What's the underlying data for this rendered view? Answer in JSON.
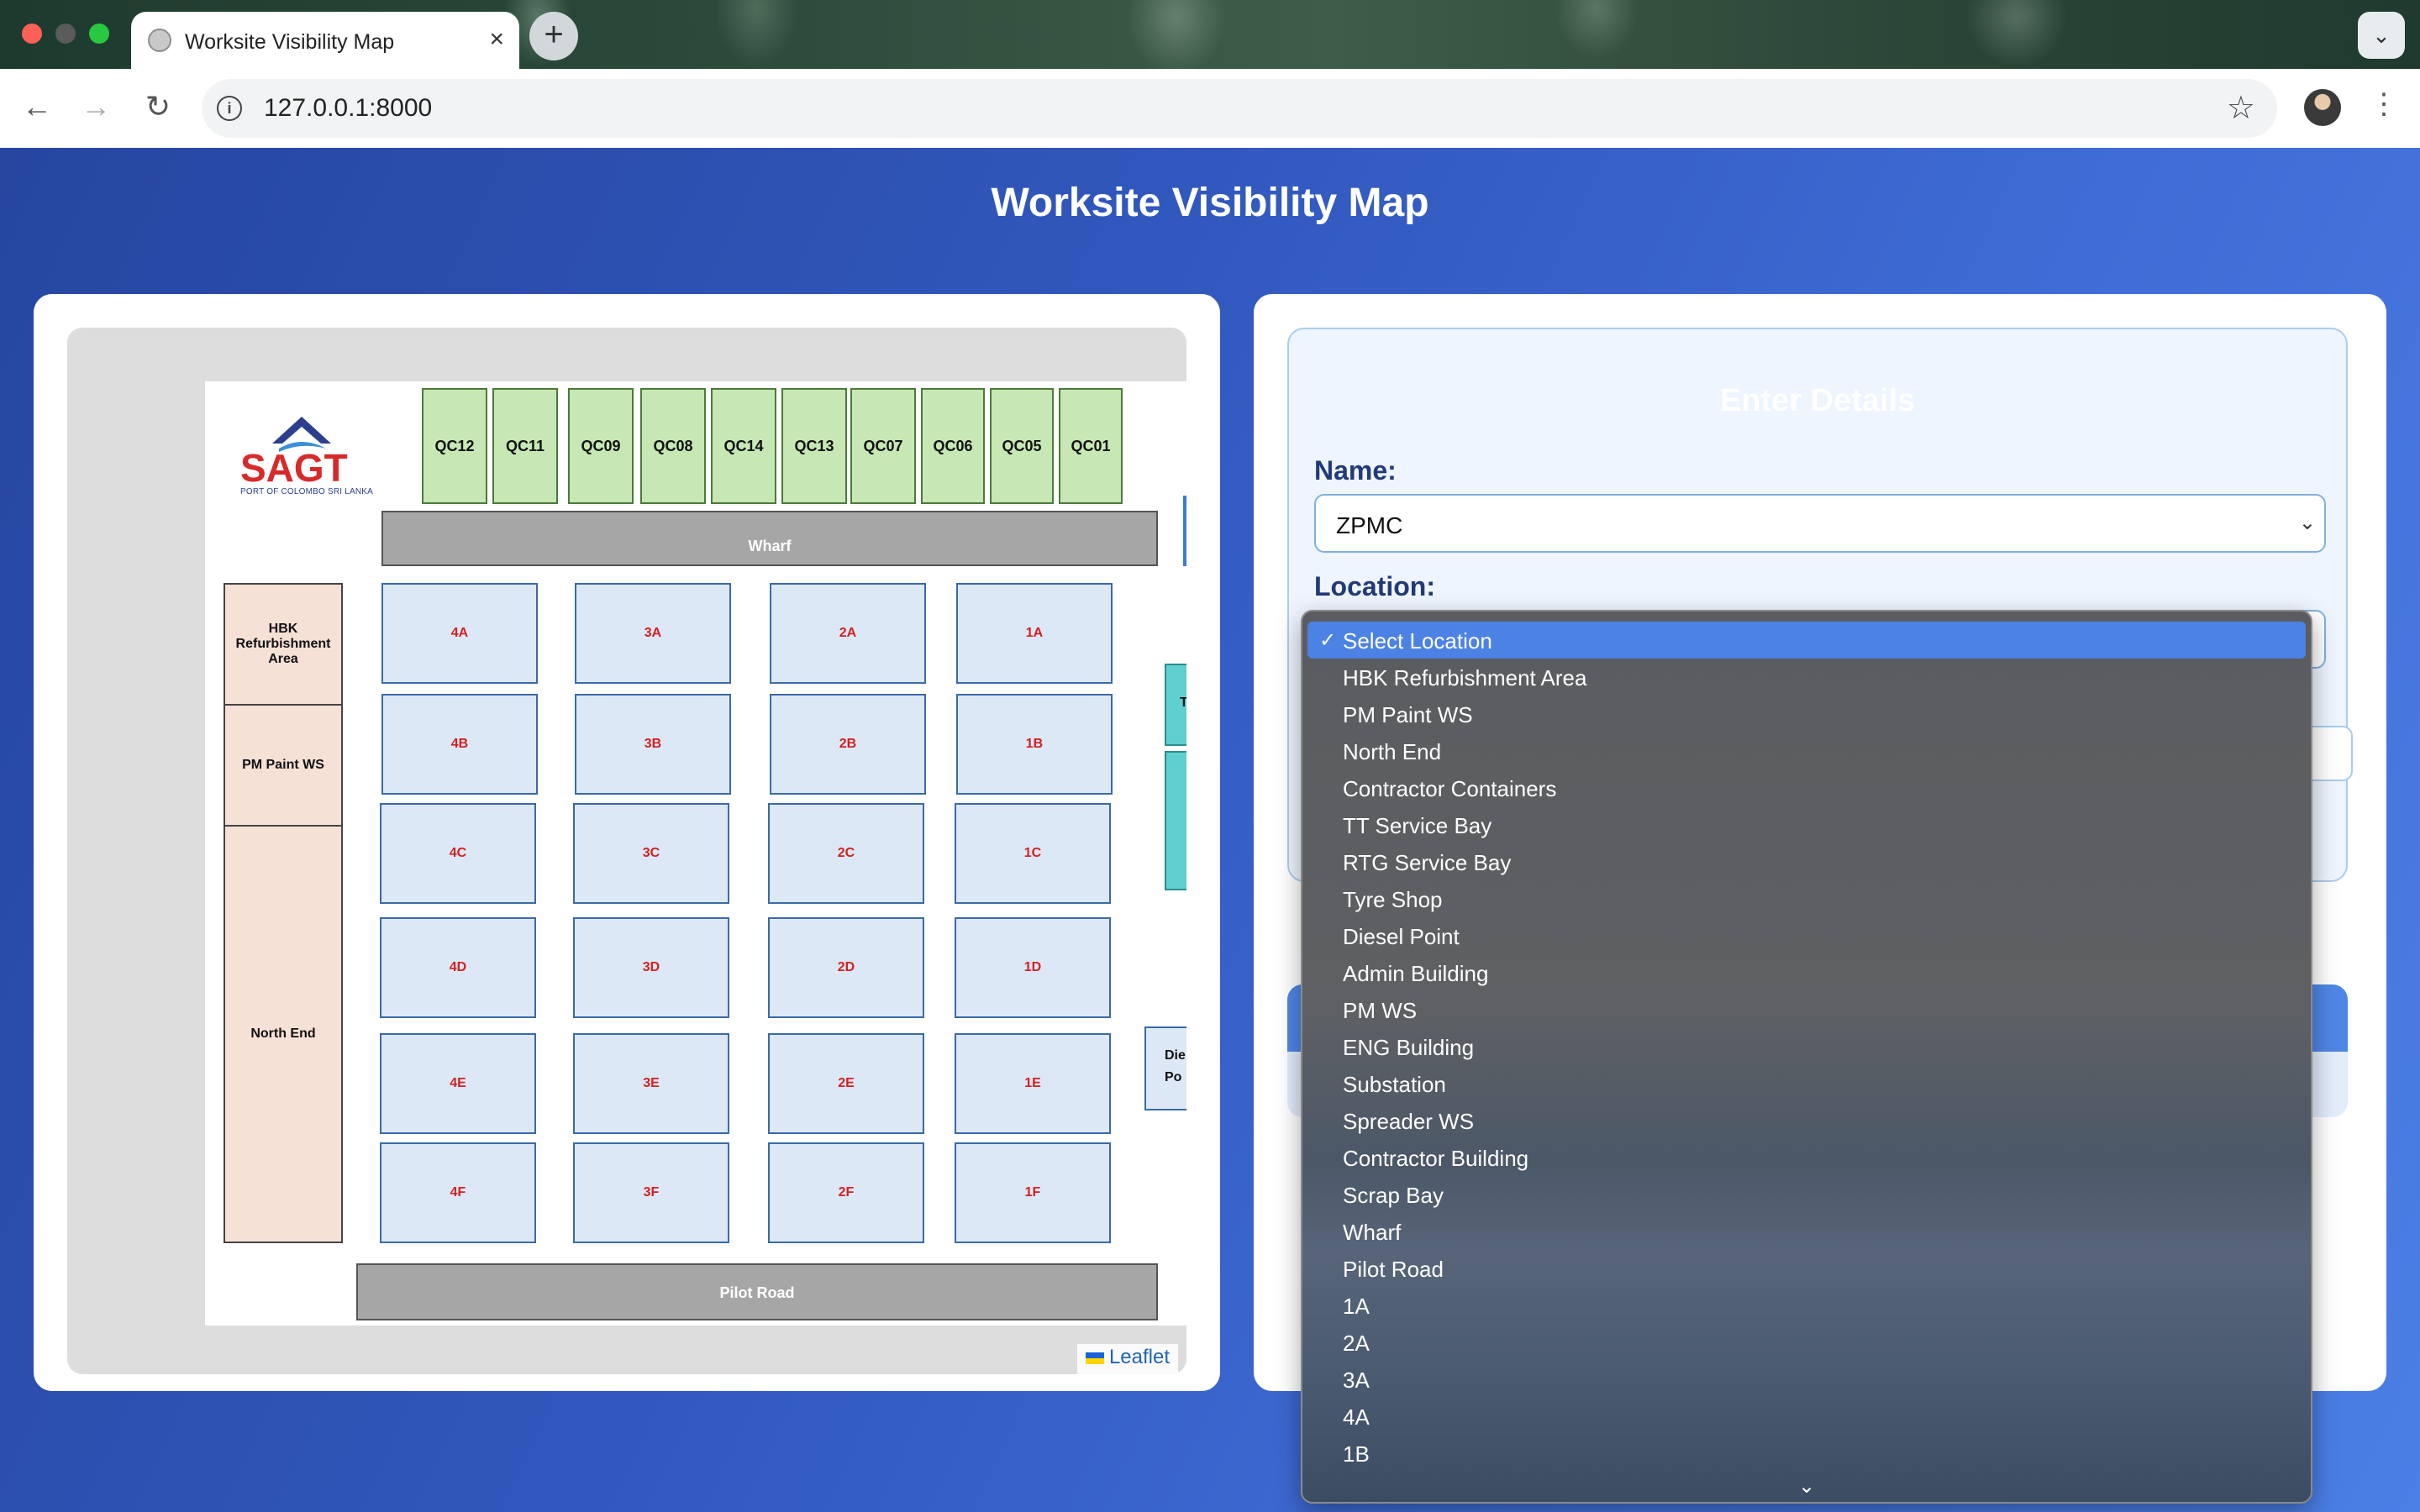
{
  "browser": {
    "tab_title": "Worksite Visibility Map",
    "tab_close": "×",
    "new_tab": "+",
    "tab_menu": "⌄",
    "url": "127.0.0.1:8000",
    "info_glyph": "i",
    "back": "←",
    "forward": "→",
    "reload": "↻",
    "star": "☆",
    "menu": "⋮"
  },
  "page": {
    "title": "Worksite Visibility Map"
  },
  "map": {
    "logo": {
      "name": "SAGT",
      "tagline": "PORT OF COLOMBO SRI LANKA"
    },
    "cranes": [
      "QC12",
      "QC11",
      "QC09",
      "QC08",
      "QC14",
      "QC13",
      "QC07",
      "QC06",
      "QC05",
      "QC01"
    ],
    "wharf": "Wharf",
    "pilot_road": "Pilot Road",
    "zones": {
      "hbk": "HBK Refurbishment Area",
      "pm_paint": "PM Paint WS",
      "north_end": "North End"
    },
    "blocks": [
      [
        "4A",
        "3A",
        "2A",
        "1A"
      ],
      [
        "4B",
        "3B",
        "2B",
        "1B"
      ],
      [
        "4C",
        "3C",
        "2C",
        "1C"
      ],
      [
        "4D",
        "3D",
        "2D",
        "1D"
      ],
      [
        "4E",
        "3E",
        "2E",
        "1E"
      ],
      [
        "4F",
        "3F",
        "2F",
        "1F"
      ]
    ],
    "teal_label": "T",
    "diesel_label_line1": "Die",
    "diesel_label_line2": "Po",
    "attribution": "Leaflet"
  },
  "form": {
    "title": "Enter Details",
    "name_label": "Name:",
    "name_value": "ZPMC",
    "location_label": "Location:",
    "chevron": "⌄"
  },
  "dropdown": {
    "check": "✓",
    "options": [
      "Select Location",
      "HBK Refurbishment Area",
      "PM Paint WS",
      "North End",
      "Contractor Containers",
      "TT Service Bay",
      "RTG Service Bay",
      "Tyre Shop",
      "Diesel Point",
      "Admin Building",
      "PM WS",
      "ENG Building",
      "Substation",
      "Spreader WS",
      "Contractor Building",
      "Scrap Bay",
      "Wharf",
      "Pilot Road",
      "1A",
      "2A",
      "3A",
      "4A",
      "1B"
    ],
    "selected_index": 0,
    "more_indicator": "⌄"
  },
  "colors": {
    "accent": "#4d82e5",
    "crane_fill": "#c7e8b4",
    "block_fill": "#dde8f6",
    "block_label": "#d32020",
    "zone_fill": "#f6e1d7",
    "road_fill": "#a6a6a6"
  }
}
